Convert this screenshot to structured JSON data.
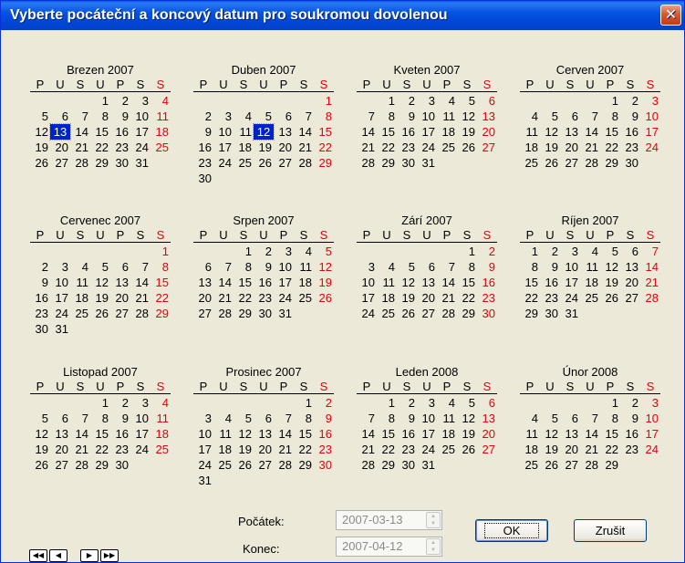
{
  "window": {
    "title": "Vyberte pocáteční a koncový datum pro soukromou dovolenou",
    "close_glyph": "✕"
  },
  "weekday_headers": [
    "P",
    "U",
    "S",
    "U",
    "P",
    "S",
    "S"
  ],
  "months": [
    {
      "title": "Brezen 2007",
      "offset": 3,
      "days": 31,
      "selected": 13
    },
    {
      "title": "Duben 2007",
      "offset": 6,
      "days": 30,
      "selected": 12
    },
    {
      "title": "Kveten 2007",
      "offset": 1,
      "days": 31,
      "selected": null
    },
    {
      "title": "Cerven 2007",
      "offset": 4,
      "days": 30,
      "selected": null
    },
    {
      "title": "Cervenec 2007",
      "offset": 6,
      "days": 31,
      "selected": null
    },
    {
      "title": "Srpen 2007",
      "offset": 2,
      "days": 31,
      "selected": null
    },
    {
      "title": "Zárí 2007",
      "offset": 5,
      "days": 30,
      "selected": null
    },
    {
      "title": "Ríjen 2007",
      "offset": 0,
      "days": 31,
      "selected": null
    },
    {
      "title": "Listopad 2007",
      "offset": 3,
      "days": 30,
      "selected": null
    },
    {
      "title": "Prosinec 2007",
      "offset": 5,
      "days": 31,
      "selected": null
    },
    {
      "title": "Leden 2008",
      "offset": 1,
      "days": 31,
      "selected": null
    },
    {
      "title": "Únor 2008",
      "offset": 4,
      "days": 29,
      "selected": null
    }
  ],
  "nav": {
    "first": "◀◀",
    "prev": "◀",
    "next": "▶",
    "last": "▶▶"
  },
  "form": {
    "start_label": "Počátek:",
    "start_value": "2007-03-13",
    "end_label": "Konec:",
    "end_value": "2007-04-12",
    "spin_up": "▲",
    "spin_down": "▼"
  },
  "buttons": {
    "ok": "OK",
    "cancel": "Zrušit"
  },
  "colors": {
    "sunday": "#e3000b",
    "selected_bg": "#0022cc",
    "titlebar": "#0553e3"
  }
}
